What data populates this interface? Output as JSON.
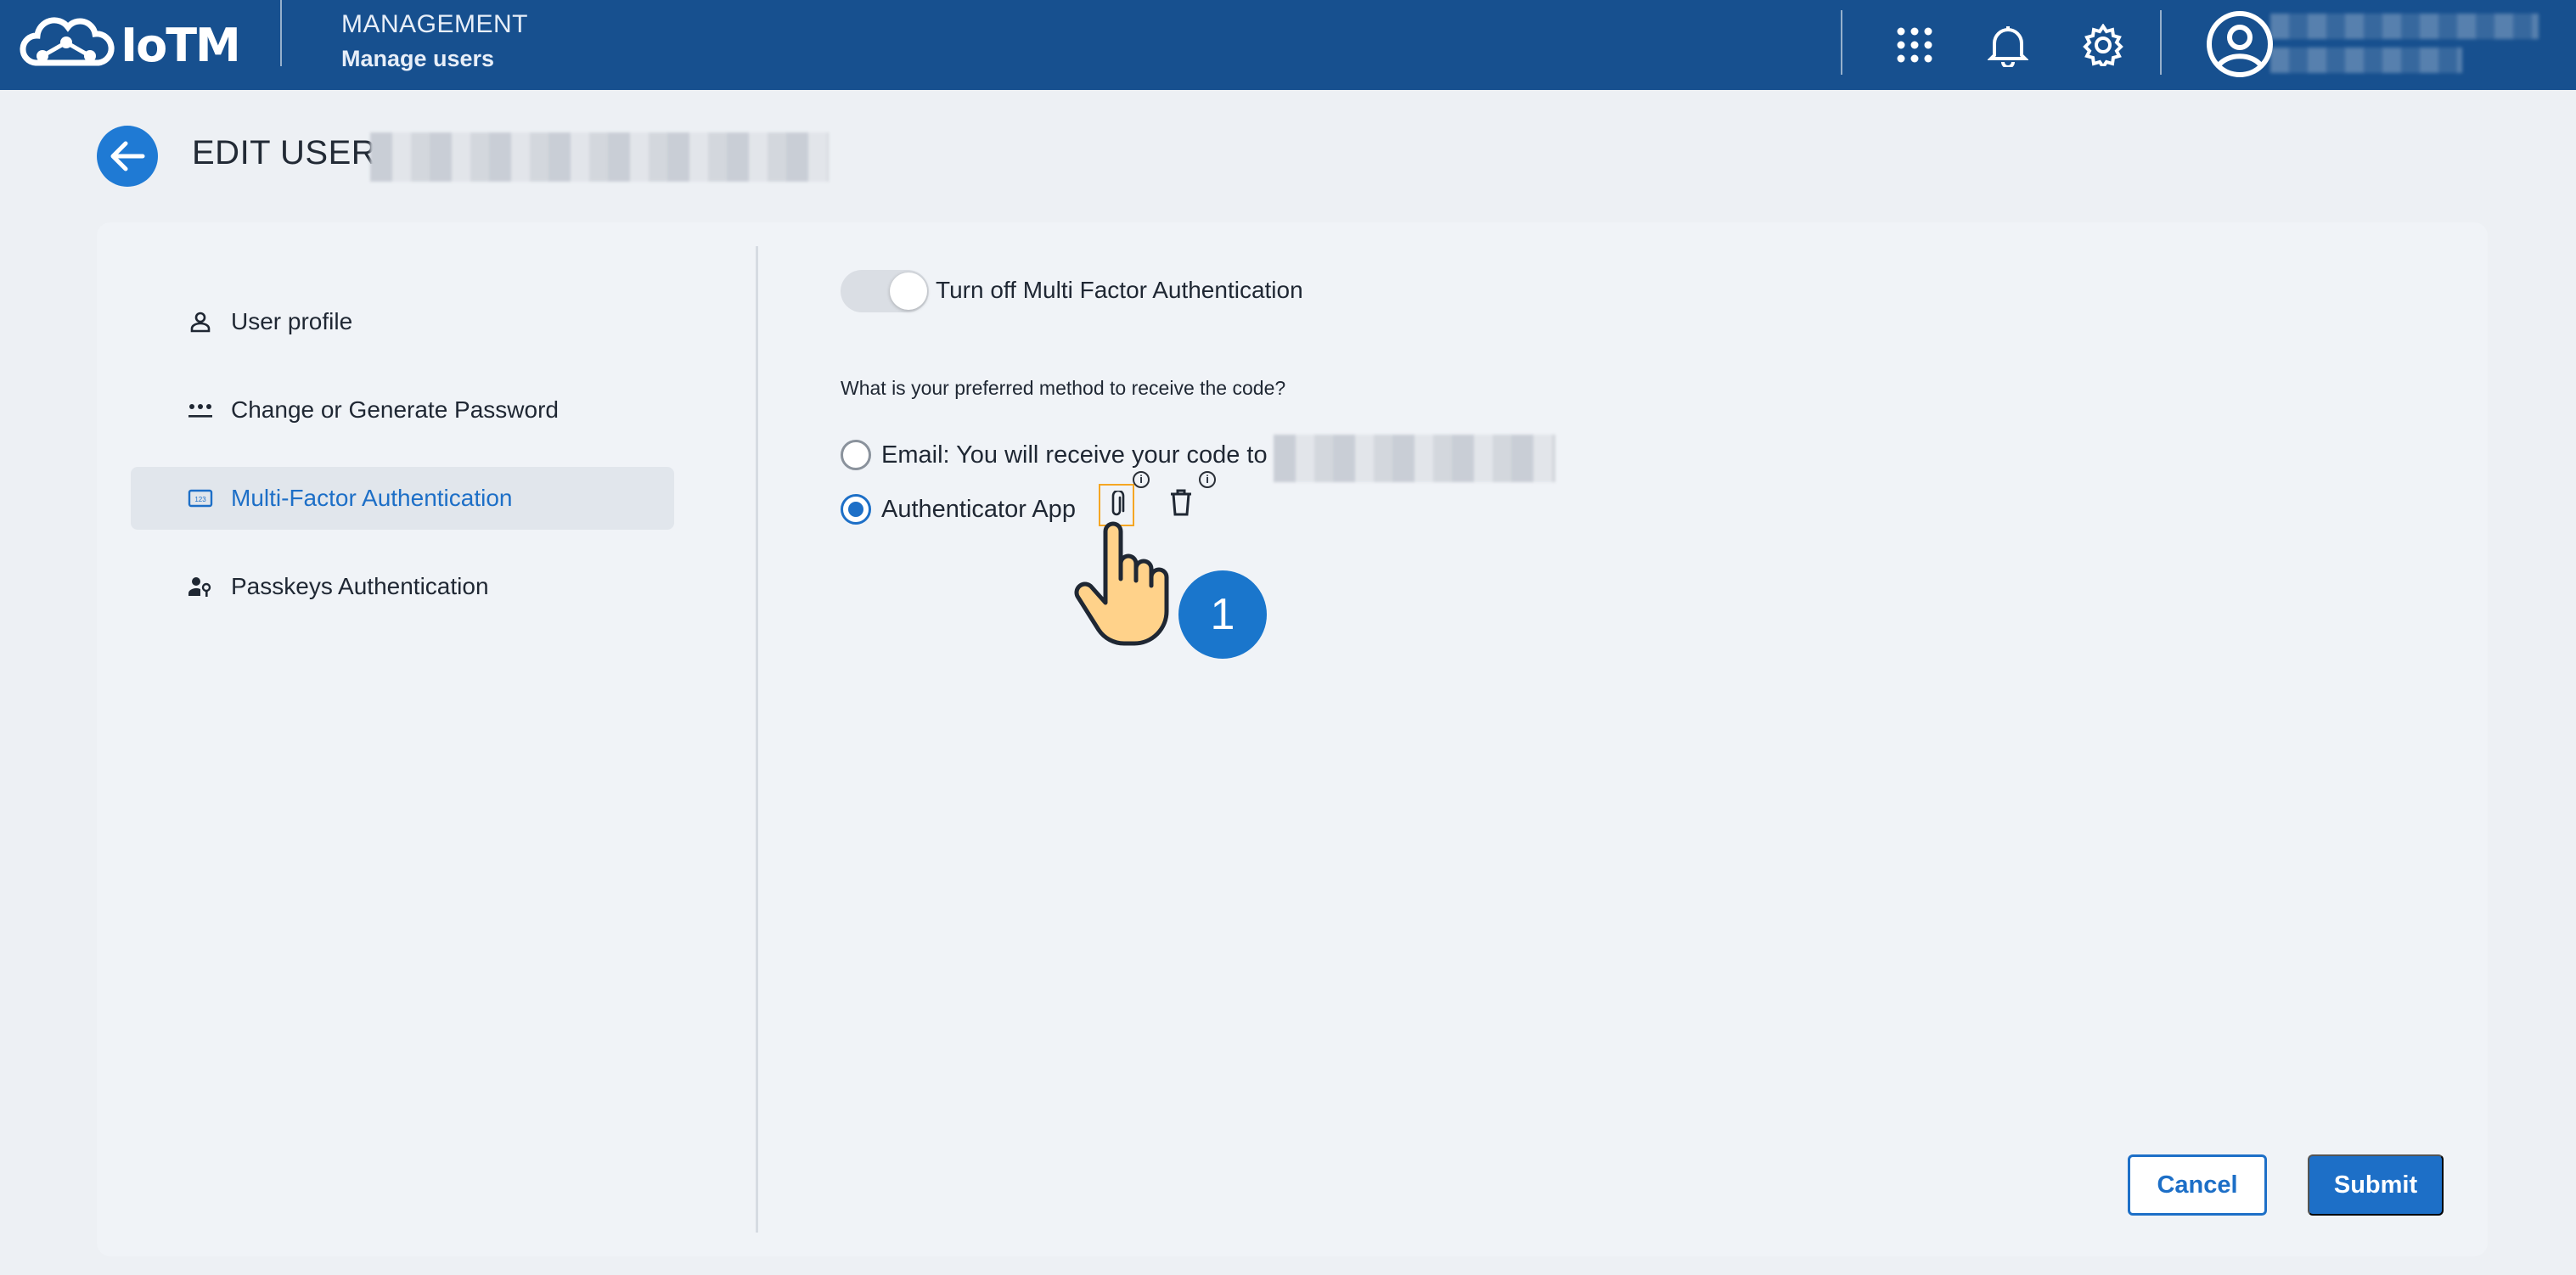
{
  "app": {
    "logo_text": "IoTM",
    "module_name": "MANAGEMENT",
    "module_subtitle": "Manage users"
  },
  "page": {
    "title": "EDIT USER:"
  },
  "sidebar": {
    "items": [
      {
        "label": "User profile",
        "icon": "person-icon",
        "active": false
      },
      {
        "label": "Change or Generate Password",
        "icon": "password-dots-icon",
        "active": false
      },
      {
        "label": "Multi-Factor Authentication",
        "icon": "pin-icon",
        "active": true
      },
      {
        "label": "Passkeys Authentication",
        "icon": "person-key-icon",
        "active": false
      }
    ]
  },
  "mfa": {
    "toggle_label": "Turn off Multi Factor Authentication",
    "question": "What is your preferred method to receive the code?",
    "options": [
      {
        "label": "Email: You will receive your code to",
        "selected": false
      },
      {
        "label": "Authenticator App",
        "selected": true
      }
    ]
  },
  "annotation": {
    "step": "1"
  },
  "actions": {
    "cancel_label": "Cancel",
    "submit_label": "Submit"
  },
  "colors": {
    "topbar": "#17508f",
    "accent": "#1d6fc7",
    "highlight": "#f5a623"
  }
}
